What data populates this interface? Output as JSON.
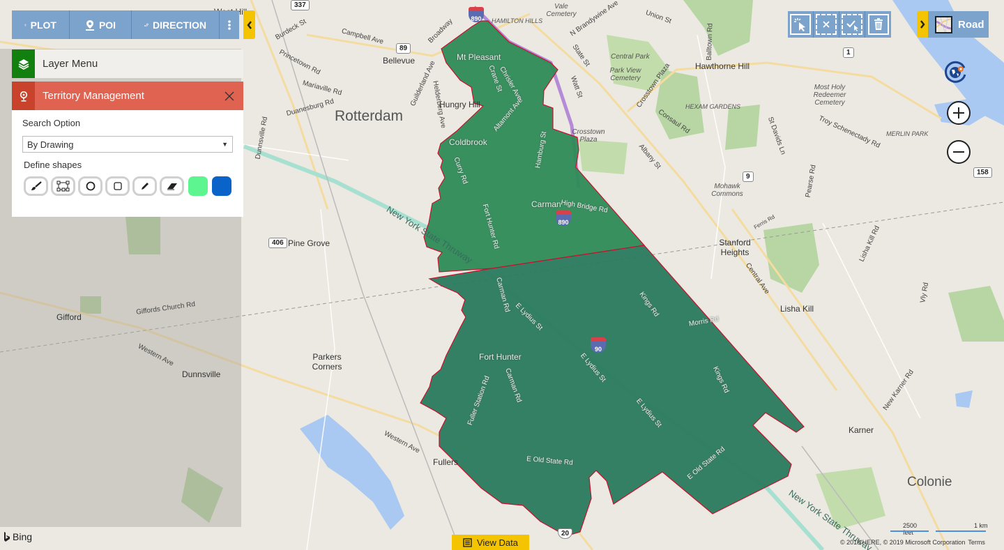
{
  "toolbar": {
    "plot": "PLOT",
    "poi": "POI",
    "direction": "DIRECTION",
    "icons": [
      "pin-icon",
      "poi-pin-icon",
      "route-icon",
      "more-vertical-icon"
    ],
    "collapse_icon": "chevron-left-icon"
  },
  "layer_menu": {
    "label": "Layer Menu",
    "icon": "layers-icon",
    "icon_bg": "#12800f"
  },
  "territory": {
    "title": "Territory Management",
    "icon": "pin-icon",
    "header_color": "#e06352",
    "search_option_label": "Search Option",
    "search_option_value": "By Drawing",
    "define_shapes_label": "Define shapes",
    "shape_tools": [
      "brush-icon",
      "polygon-select-icon",
      "circle-icon",
      "square-icon",
      "pencil-icon",
      "eraser-icon"
    ],
    "swatches": [
      "#5cf590",
      "#0a63c9"
    ]
  },
  "select_tools": [
    "select-pointer-icon",
    "clear-selection-icon",
    "confirm-selection-icon",
    "trash-icon"
  ],
  "map_style": {
    "label": "Road",
    "toggle_icon": "chevron-right-icon"
  },
  "map_controls": {
    "locate": "locate-globe-icon",
    "zoom_in": "+",
    "zoom_out": "−"
  },
  "footer": {
    "brand": "Bing",
    "view_data": "View Data",
    "scale_imperial": "2500 feet",
    "scale_metric": "1 km",
    "copyright": "© 2018 HERE, © 2019 Microsoft Corporation",
    "terms": "Terms"
  },
  "territories": [
    {
      "name": "north-territory",
      "fill": "#2e8b57"
    },
    {
      "name": "south-territory",
      "fill": "#2a7a5e"
    }
  ],
  "map_labels": {
    "cities": [
      "Rotterdam",
      "Colonie"
    ],
    "places": [
      "Bellevue",
      "Hungry Hill",
      "Hawthorne Hill",
      "Stanford Heights",
      "Lisha Kill",
      "Karner",
      "Pine Grove",
      "Parkers Corners",
      "Gifford",
      "Dunnsville",
      "Fullers",
      "West Hill"
    ],
    "areas": [
      "HAMILTON HILLS",
      "HEXAM GARDENS",
      "MERLIN PARK"
    ],
    "landmarks": [
      "Vale Cemetery",
      "Central Park",
      "Park View Cemetery",
      "Crosstown Plaza",
      "Most Holy Redeemer Cemetery",
      "Mohawk Commons"
    ],
    "roads": [
      "Burdeck St",
      "Campbell Ave",
      "Princetown Rd",
      "Mariaville Rd",
      "Duanesburg Rd",
      "Broadway",
      "Guilderland Ave",
      "Helderberg Ave",
      "Dunnsville Rd",
      "Union St",
      "N Brandywine Ave",
      "State St",
      "Watt St",
      "Balltown Rd",
      "Crosstown Plaza",
      "Consaul Rd",
      "Albany St",
      "St Davids Ln",
      "Troy Schenectady Rd",
      "Pearse Rd",
      "Ferris Rd",
      "Lisha Kill Rd",
      "Central Ave",
      "Vly Rd",
      "New Karner Rd",
      "Giffords Church Rd",
      "Western Ave",
      "New York State Thruway",
      "Morris Rd"
    ],
    "territory_places": [
      "Mt Pleasant",
      "Coldbrook",
      "Carman",
      "Fort Hunter"
    ],
    "territory_roads": [
      "Crane St",
      "Chrisler Ave",
      "Altamont Ave",
      "Hamburg St",
      "Curry Rd",
      "Fort Hunter Rd",
      "High Bridge Rd",
      "Carman Rd",
      "E Lydius St",
      "Kings Rd",
      "Fuller Station Rd",
      "E Old State Rd"
    ],
    "shields": [
      "337",
      "89",
      "1",
      "9",
      "158",
      "406",
      "20"
    ],
    "interstates": [
      "890",
      "890",
      "90"
    ]
  }
}
